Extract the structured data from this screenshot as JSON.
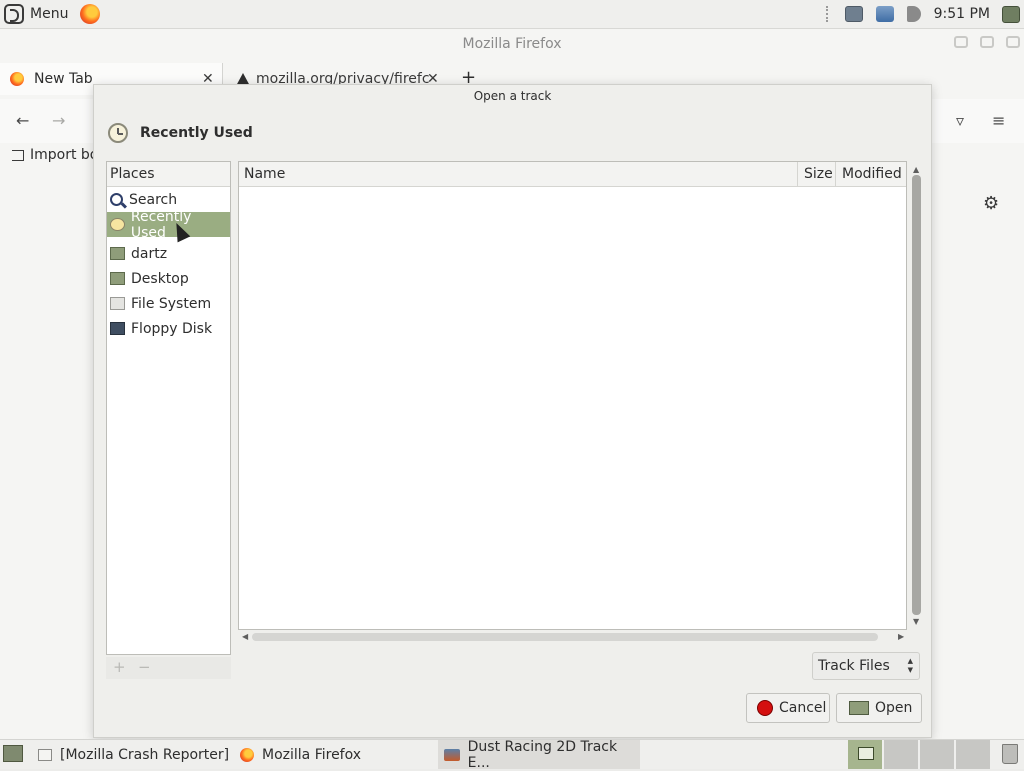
{
  "top_panel": {
    "menu_label": "Menu",
    "clock": "9:51 PM"
  },
  "firefox": {
    "window_title": "Mozilla Firefox",
    "tabs": [
      {
        "label": "New Tab"
      },
      {
        "label": "mozilla.org/privacy/firefc"
      }
    ],
    "new_tab_glyph": "+",
    "bookmarks": {
      "import_label": "Import bo"
    }
  },
  "dialog": {
    "title": "Open a track",
    "location_label": "Recently Used",
    "places_header": "Places",
    "places": [
      {
        "label": "Search",
        "icon": "search-icon"
      },
      {
        "label": "Recently Used",
        "icon": "recent-icon"
      },
      {
        "label": "dartz",
        "icon": "home-folder-icon"
      },
      {
        "label": "Desktop",
        "icon": "desktop-folder-icon"
      },
      {
        "label": "File System",
        "icon": "filesystem-icon"
      },
      {
        "label": "Floppy Disk",
        "icon": "floppy-icon"
      }
    ],
    "columns": {
      "name": "Name",
      "size": "Size",
      "modified": "Modified"
    },
    "filter_value": "Track Files",
    "cancel_label": "Cancel",
    "open_label": "Open",
    "add_glyph": "+",
    "remove_glyph": "−"
  },
  "taskbar": {
    "items": [
      {
        "label": "[Mozilla Crash Reporter]"
      },
      {
        "label": "Mozilla Firefox"
      },
      {
        "label": "Dust Racing 2D Track E..."
      }
    ]
  }
}
